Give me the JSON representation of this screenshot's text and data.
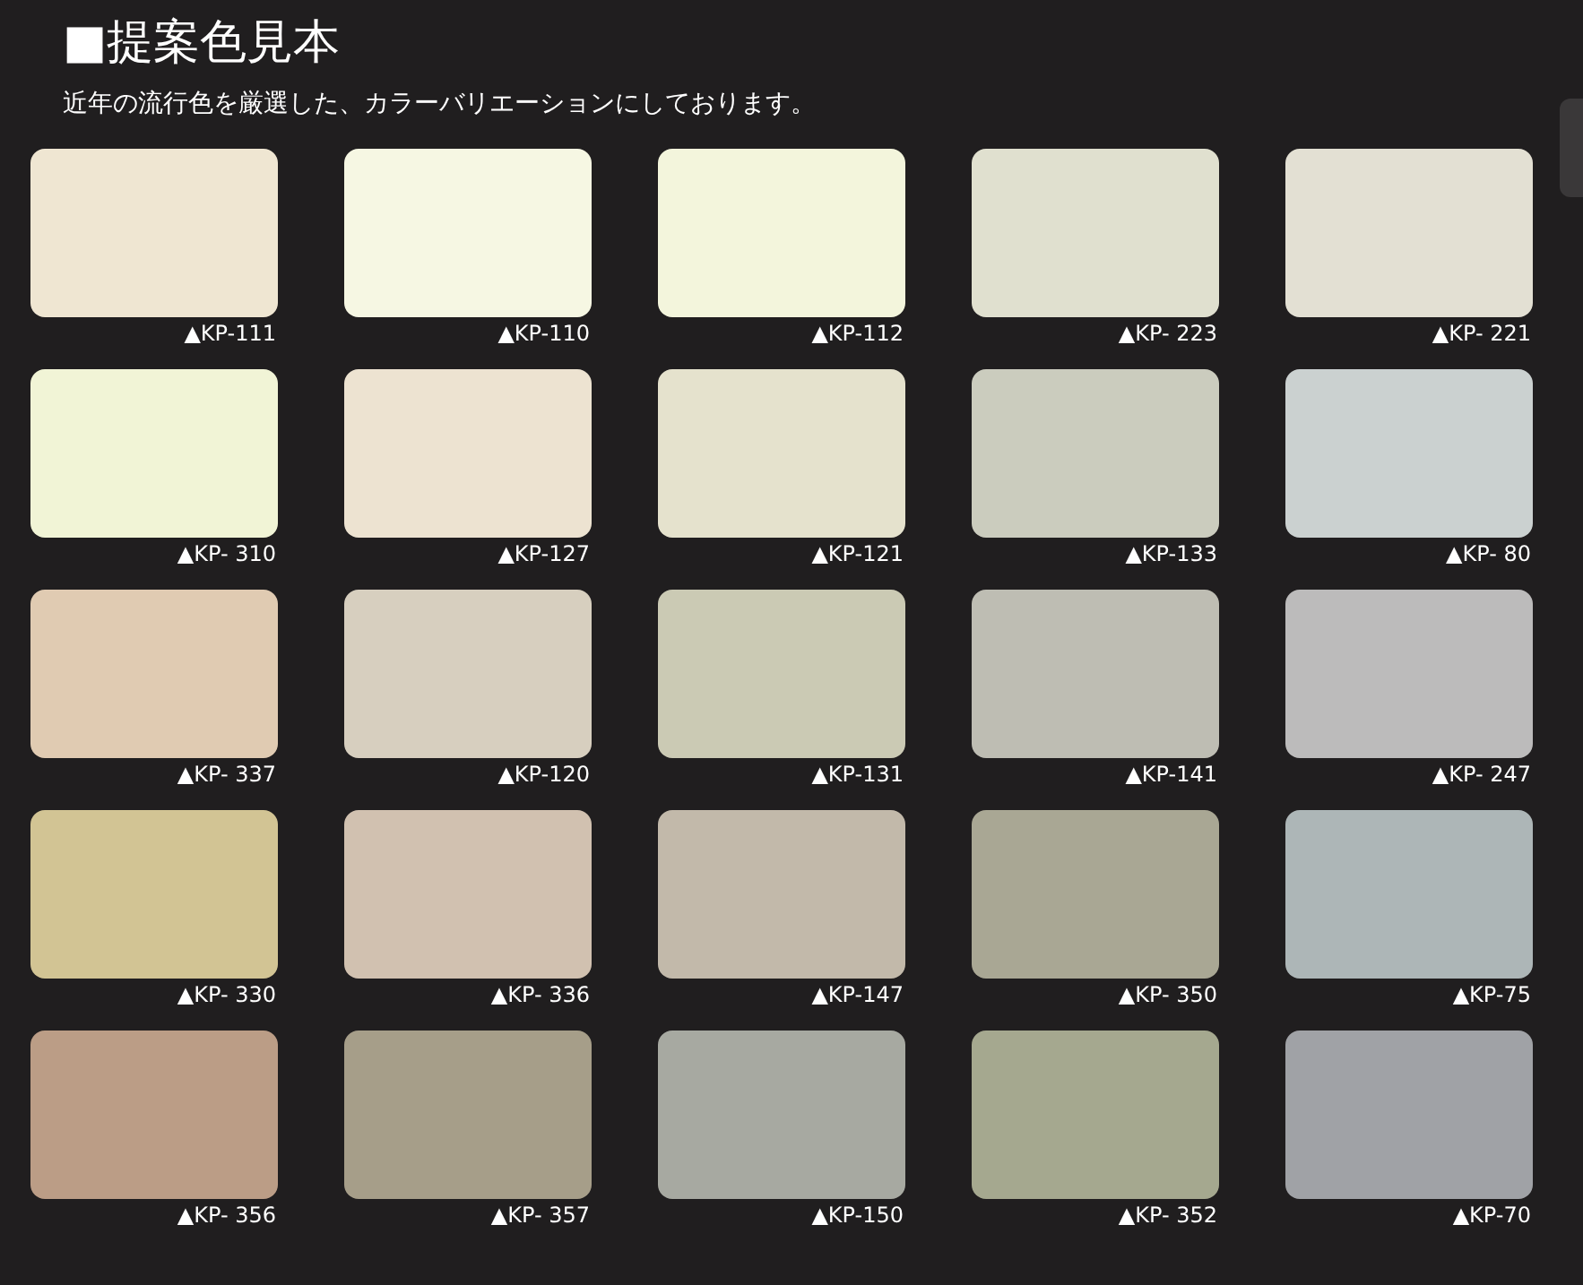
{
  "title": "■提案色見本",
  "description": "近年の流行色を厳選した、カラーバリエーションにしております。",
  "swatches": [
    {
      "label": "▲KP-111",
      "color": "#efe6d2"
    },
    {
      "label": "▲KP-110",
      "color": "#f6f7e3"
    },
    {
      "label": "▲KP-112",
      "color": "#f3f5dc"
    },
    {
      "label": "▲KP- 223",
      "color": "#e0e0cf"
    },
    {
      "label": "▲KP- 221",
      "color": "#e3e0d3"
    },
    {
      "label": "▲KP- 310",
      "color": "#f1f4d6"
    },
    {
      "label": "▲KP-127",
      "color": "#ede3d1"
    },
    {
      "label": "▲KP-121",
      "color": "#e5e2cd"
    },
    {
      "label": "▲KP-133",
      "color": "#cbccbe"
    },
    {
      "label": "▲KP- 80",
      "color": "#cbd1d0"
    },
    {
      "label": "▲KP- 337",
      "color": "#e0cbb2"
    },
    {
      "label": "▲KP-120",
      "color": "#d7cfbf"
    },
    {
      "label": "▲KP-131",
      "color": "#cbcab4"
    },
    {
      "label": "▲KP-141",
      "color": "#bebdb3"
    },
    {
      "label": "▲KP- 247",
      "color": "#bcbbbb"
    },
    {
      "label": "▲KP- 330",
      "color": "#d2c494"
    },
    {
      "label": "▲KP- 336",
      "color": "#d1c1b0"
    },
    {
      "label": "▲KP-147",
      "color": "#c2b9aa"
    },
    {
      "label": "▲KP- 350",
      "color": "#a9a794"
    },
    {
      "label": "▲KP-75",
      "color": "#adb6b7"
    },
    {
      "label": "▲KP- 356",
      "color": "#bb9d86"
    },
    {
      "label": "▲KP- 357",
      "color": "#a69e89"
    },
    {
      "label": "▲KP-150",
      "color": "#a7a9a1"
    },
    {
      "label": "▲KP- 352",
      "color": "#a5a88f"
    },
    {
      "label": "▲KP-70",
      "color": "#a0a2a6"
    }
  ]
}
